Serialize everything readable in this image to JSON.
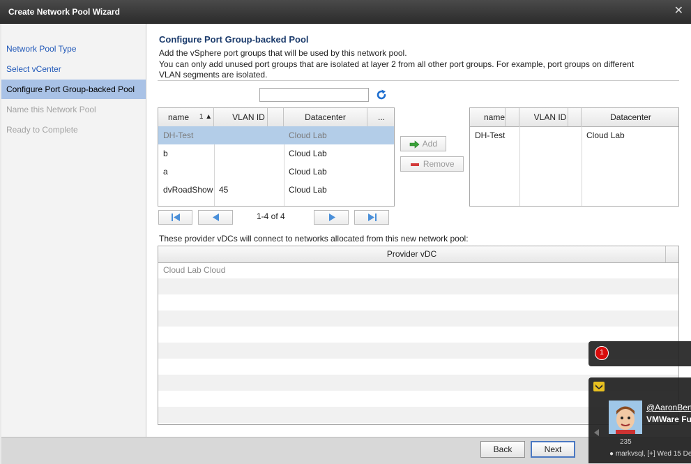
{
  "window": {
    "title": "Create Network Pool Wizard",
    "close_glyph": "✕"
  },
  "sidebar": {
    "items": [
      {
        "label": "Network Pool Type"
      },
      {
        "label": "Select vCenter"
      },
      {
        "label": "Configure Port Group-backed Pool"
      },
      {
        "label": "Name this Network Pool"
      },
      {
        "label": "Ready to Complete"
      }
    ]
  },
  "main": {
    "heading": "Configure Port Group-backed Pool",
    "desc1": "Add the vSphere port groups that will be used by this network pool.",
    "desc2": "You can only add unused port groups that are isolated at layer 2 from all other port groups. For example, port groups on different",
    "desc3": "VLAN segments are isolated.",
    "search": {
      "value": "",
      "placeholder": ""
    }
  },
  "available": {
    "columns": [
      "name",
      "VLAN ID",
      "Datacenter",
      "..."
    ],
    "sort_indicator": "1 ▲",
    "rows": [
      {
        "name": "DH-Test",
        "vlan": "",
        "datacenter": "Cloud Lab"
      },
      {
        "name": "b",
        "vlan": "",
        "datacenter": "Cloud Lab"
      },
      {
        "name": "a",
        "vlan": "",
        "datacenter": "Cloud Lab"
      },
      {
        "name": "dvRoadShow",
        "vlan": "45",
        "datacenter": "Cloud Lab"
      }
    ]
  },
  "pager": {
    "text": "1-4 of 4"
  },
  "actions": {
    "add_label": "Add",
    "remove_label": "Remove"
  },
  "selected": {
    "columns": [
      "name",
      "VLAN ID",
      "Datacenter"
    ],
    "rows": [
      {
        "name": "DH-Test",
        "vlan": "",
        "datacenter": "Cloud Lab"
      }
    ]
  },
  "provider": {
    "caption": "These provider vDCs will connect to networks allocated from this new network pool:",
    "column": "Provider vDC",
    "rows": [
      "Cloud Lab Cloud"
    ]
  },
  "footer": {
    "back_label": "Back",
    "next_label": "Next"
  },
  "notification": {
    "badge_count": "1",
    "user": "@AaronBert",
    "message": "VMWare Fus",
    "count": "235",
    "meta": "● markvsql, [+] Wed 15 De"
  },
  "colors": {
    "accent": "#1f57b8",
    "selection": "#b3cde8",
    "nav_active": "#a9c2e6",
    "badge": "#d90b0b"
  }
}
